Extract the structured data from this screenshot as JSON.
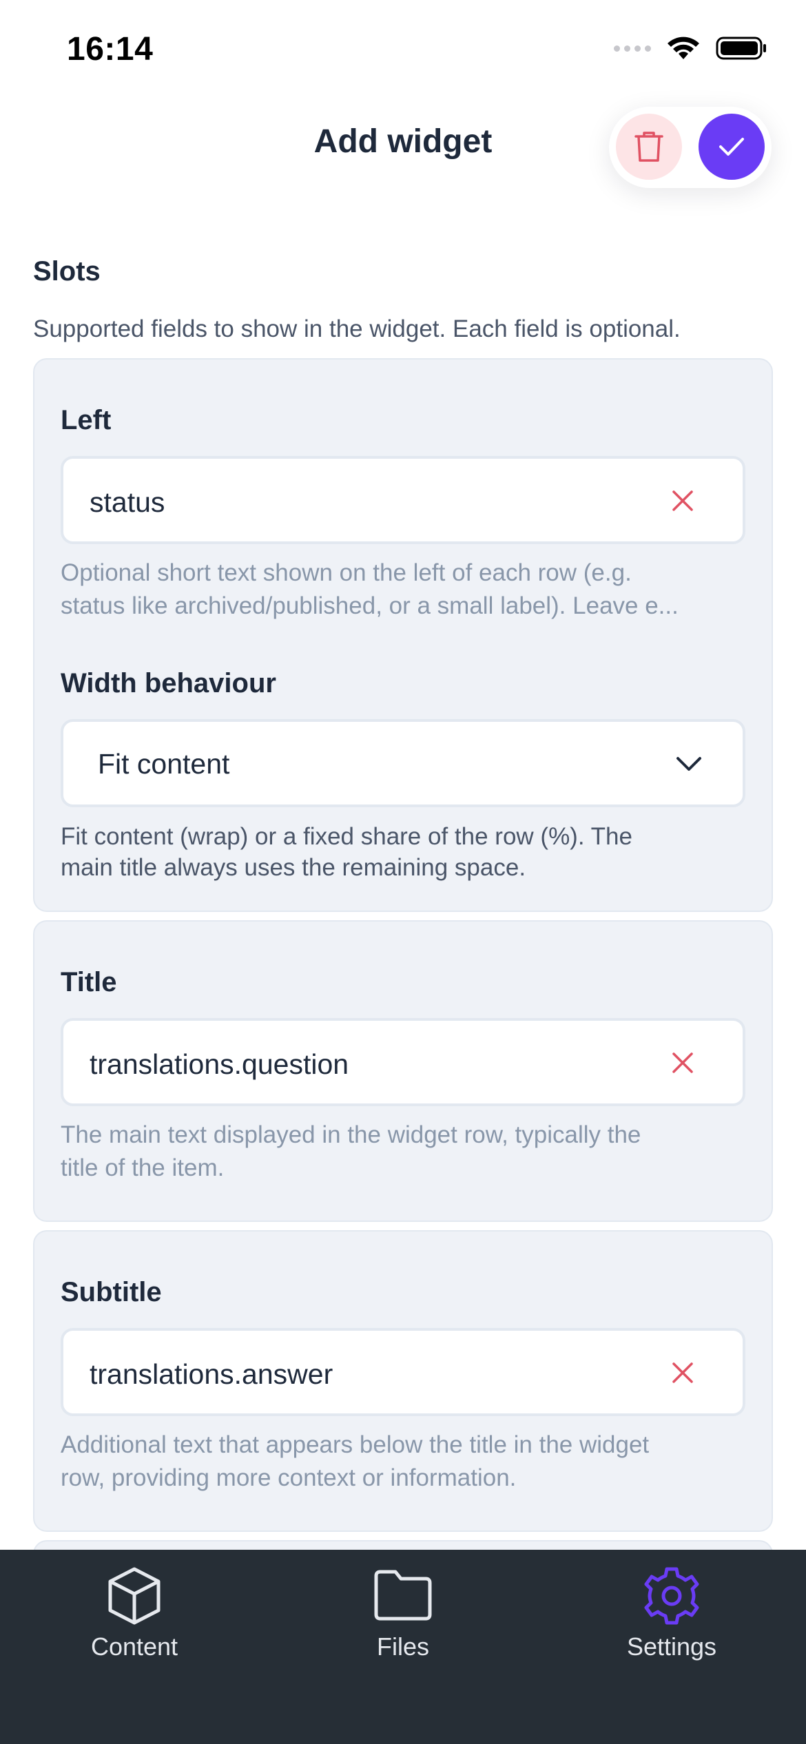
{
  "status_bar": {
    "time": "16:14"
  },
  "header": {
    "title": "Add widget"
  },
  "slots": {
    "title": "Slots",
    "description": "Supported fields to show in the widget. Each field is optional.",
    "left": {
      "label": "Left",
      "value": "status",
      "helper": "Optional short text shown on the left of each row (e.g. status like archived/published, or a small label). Leave e...",
      "helper_line1": "Optional short text shown on the left of each row (e.g.",
      "helper_line2": "status like archived/published, or a small label). Leave e...",
      "width_label": "Width behaviour",
      "width_value": "Fit content",
      "width_helper_line1": "Fit content (wrap) or a fixed share of the row (%). The",
      "width_helper_line2": "main title always uses the remaining space."
    },
    "title_slot": {
      "label": "Title",
      "value": "translations.question",
      "helper_line1": "The main text displayed in the widget row, typically the",
      "helper_line2": "title of the item."
    },
    "subtitle_slot": {
      "label": "Subtitle",
      "value": "translations.answer",
      "helper_line1": "Additional text that appears below the title in the widget",
      "helper_line2": "row, providing more context or information."
    }
  },
  "tab_bar": {
    "tabs": [
      {
        "label": "Content",
        "icon": "cube-icon",
        "active": false
      },
      {
        "label": "Files",
        "icon": "folder-icon",
        "active": false
      },
      {
        "label": "Settings",
        "icon": "gear-icon",
        "active": true
      }
    ]
  },
  "colors": {
    "accent": "#6a3cf5",
    "danger": "#e05263",
    "card_bg": "#eff2f7",
    "tab_bar_bg": "#262e36"
  }
}
